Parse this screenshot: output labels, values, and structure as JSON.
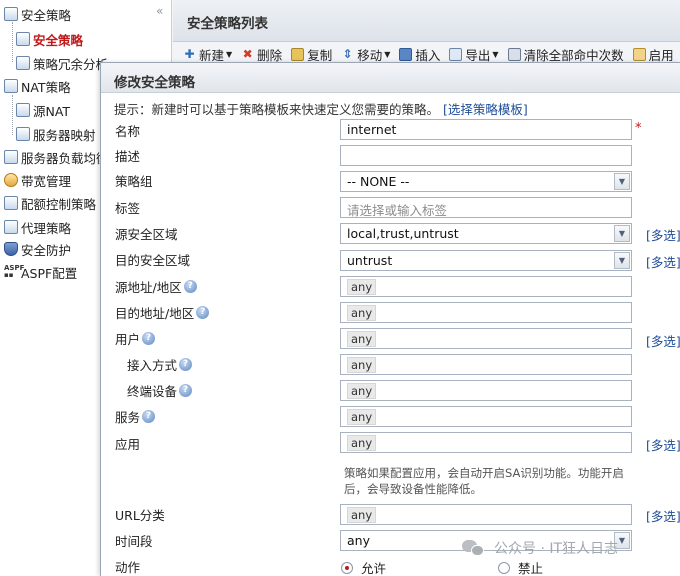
{
  "nav": {
    "collapse_glyph": "«",
    "items": [
      {
        "label": "安全策略",
        "icon": "policy-icon"
      },
      {
        "label": "安全策略",
        "icon": "policy-icon",
        "active": true
      },
      {
        "label": "策略冗余分析",
        "icon": "analysis-icon"
      },
      {
        "label": "NAT策略",
        "icon": "nat-icon"
      },
      {
        "label": "源NAT",
        "icon": "nat-icon"
      },
      {
        "label": "服务器映射",
        "icon": "server-icon"
      },
      {
        "label": "服务器负载均衡",
        "icon": "server-icon"
      },
      {
        "label": "带宽管理",
        "icon": "gauge-icon"
      },
      {
        "label": "配额控制策略",
        "icon": "quota-icon"
      },
      {
        "label": "代理策略",
        "icon": "proxy-icon"
      },
      {
        "label": "安全防护",
        "icon": "shield-icon"
      },
      {
        "label": "ASPF配置",
        "icon": "aspf-icon"
      }
    ]
  },
  "panel": {
    "title": "安全策略列表",
    "toolbar": [
      "新建",
      "删除",
      "复制",
      "移动",
      "插入",
      "导出",
      "清除全部命中次数",
      "启用"
    ]
  },
  "dialog": {
    "title": "修改安全策略",
    "hint": "提示：新建时可以基于策略模板来快速定义您需要的策略。",
    "hint_link": "[选择策略模板]",
    "multi_label": "[多选]",
    "fields": {
      "name": {
        "label": "名称",
        "value": "internet"
      },
      "desc": {
        "label": "描述",
        "value": ""
      },
      "group": {
        "label": "策略组",
        "value": "-- NONE --"
      },
      "tag": {
        "label": "标签",
        "placeholder": "请选择或输入标签"
      },
      "src_zone": {
        "label": "源安全区域",
        "value": "local,trust,untrust"
      },
      "dst_zone": {
        "label": "目的安全区域",
        "value": "untrust"
      },
      "src_addr": {
        "label": "源地址/地区",
        "value": "any"
      },
      "dst_addr": {
        "label": "目的地址/地区",
        "value": "any"
      },
      "user": {
        "label": "用户",
        "value": "any"
      },
      "access": {
        "label": "接入方式",
        "value": "any"
      },
      "terminal": {
        "label": "终端设备",
        "value": "any"
      },
      "service": {
        "label": "服务",
        "value": "any"
      },
      "app": {
        "label": "应用",
        "value": "any"
      },
      "url": {
        "label": "URL分类",
        "value": "any"
      },
      "time": {
        "label": "时间段",
        "value": "any"
      },
      "action": {
        "label": "动作",
        "permit": "允许",
        "deny": "禁止"
      }
    },
    "app_note": "策略如果配置应用，会自动开启SA识别功能。功能开启后，会导致设备性能降低。",
    "required_mark": "*"
  },
  "watermark": "公众号 · IT狂人日志"
}
